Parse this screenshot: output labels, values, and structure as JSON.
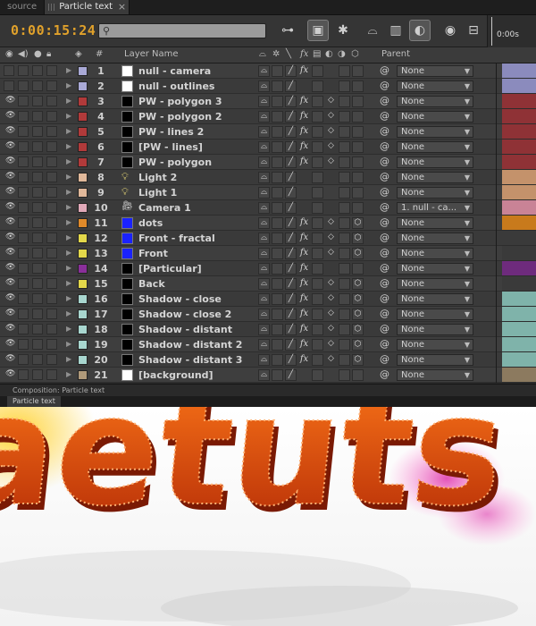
{
  "tabs": [
    {
      "label": "source",
      "active": false
    },
    {
      "label": "Particle text",
      "active": true
    }
  ],
  "toolbar": {
    "timecode": "0:00:15:24",
    "search_placeholder": "",
    "ruler_label": "0:00s"
  },
  "header": {
    "layer_name": "Layer Name",
    "hash": "#",
    "parent": "Parent"
  },
  "layers": [
    {
      "num": "1",
      "name": "null - camera",
      "label_color": "#a9a9d6",
      "src": "white",
      "eye": false,
      "fx": true,
      "switch3d": false,
      "motionblur": false,
      "parent": "None",
      "bar_color": "#8b8bbd"
    },
    {
      "num": "2",
      "name": "null - outlines",
      "label_color": "#a9a9d6",
      "src": "white",
      "eye": false,
      "fx": false,
      "switch3d": false,
      "motionblur": false,
      "parent": "None",
      "bar_color": "#8b8bbd"
    },
    {
      "num": "3",
      "name": "PW - polygon 3",
      "label_color": "#b13a3a",
      "src": "black",
      "eye": true,
      "fx": true,
      "switch3d": false,
      "motionblur": true,
      "parent": "None",
      "bar_color": "#8f3236"
    },
    {
      "num": "4",
      "name": "PW - polygon 2",
      "label_color": "#b13a3a",
      "src": "black",
      "eye": true,
      "fx": true,
      "switch3d": false,
      "motionblur": true,
      "parent": "None",
      "bar_color": "#8f3236"
    },
    {
      "num": "5",
      "name": "PW - lines 2",
      "label_color": "#b13a3a",
      "src": "black",
      "eye": true,
      "fx": true,
      "switch3d": false,
      "motionblur": true,
      "parent": "None",
      "bar_color": "#8f3236"
    },
    {
      "num": "6",
      "name": "[PW - lines]",
      "label_color": "#b13a3a",
      "src": "black",
      "eye": true,
      "fx": true,
      "switch3d": false,
      "motionblur": true,
      "parent": "None",
      "bar_color": "#8f3236"
    },
    {
      "num": "7",
      "name": "PW - polygon",
      "label_color": "#b13a3a",
      "src": "black",
      "eye": true,
      "fx": true,
      "switch3d": false,
      "motionblur": true,
      "parent": "None",
      "bar_color": "#8f3236"
    },
    {
      "num": "8",
      "name": "Light 2",
      "label_color": "#e0b89a",
      "src": "light",
      "eye": true,
      "fx": false,
      "switch3d": false,
      "motionblur": false,
      "parent": "None",
      "bar_color": "#c4926b"
    },
    {
      "num": "9",
      "name": "Light 1",
      "label_color": "#e0b89a",
      "src": "light",
      "eye": true,
      "fx": false,
      "switch3d": false,
      "motionblur": false,
      "parent": "None",
      "bar_color": "#c4926b"
    },
    {
      "num": "10",
      "name": "Camera 1",
      "label_color": "#e0a8b8",
      "src": "camera",
      "eye": true,
      "fx": false,
      "switch3d": false,
      "motionblur": false,
      "parent": "1. null - ca...",
      "bar_color": "#c98396"
    },
    {
      "num": "11",
      "name": "dots",
      "label_color": "#e08a2a",
      "src": "blue",
      "eye": true,
      "fx": true,
      "switch3d": true,
      "motionblur": true,
      "parent": "None",
      "bar_color": "#c87a1c"
    },
    {
      "num": "12",
      "name": "Front - fractal",
      "label_color": "#e3d84a",
      "src": "blue",
      "eye": true,
      "fx": true,
      "switch3d": true,
      "motionblur": true,
      "parent": "None",
      "bar_color": "#3a3a3a"
    },
    {
      "num": "13",
      "name": "Front",
      "label_color": "#e3d84a",
      "src": "blue",
      "eye": true,
      "fx": true,
      "switch3d": true,
      "motionblur": true,
      "parent": "None",
      "bar_color": "#3a3a3a"
    },
    {
      "num": "14",
      "name": "[Particular]",
      "label_color": "#8a2f9a",
      "src": "black",
      "eye": true,
      "fx": true,
      "switch3d": false,
      "motionblur": false,
      "parent": "None",
      "bar_color": "#6e2b7d"
    },
    {
      "num": "15",
      "name": "Back",
      "label_color": "#e3d84a",
      "src": "black",
      "eye": true,
      "fx": true,
      "switch3d": true,
      "motionblur": true,
      "parent": "None",
      "bar_color": "#3a3a3a"
    },
    {
      "num": "16",
      "name": "Shadow - close",
      "label_color": "#a8d6cf",
      "src": "black",
      "eye": true,
      "fx": true,
      "switch3d": true,
      "motionblur": true,
      "parent": "None",
      "bar_color": "#7fb3aa"
    },
    {
      "num": "17",
      "name": "Shadow - close 2",
      "label_color": "#a8d6cf",
      "src": "black",
      "eye": true,
      "fx": true,
      "switch3d": true,
      "motionblur": true,
      "parent": "None",
      "bar_color": "#7fb3aa"
    },
    {
      "num": "18",
      "name": "Shadow - distant",
      "label_color": "#a8d6cf",
      "src": "black",
      "eye": true,
      "fx": true,
      "switch3d": true,
      "motionblur": true,
      "parent": "None",
      "bar_color": "#7fb3aa"
    },
    {
      "num": "19",
      "name": "Shadow - distant 2",
      "label_color": "#a8d6cf",
      "src": "black",
      "eye": true,
      "fx": true,
      "switch3d": true,
      "motionblur": true,
      "parent": "None",
      "bar_color": "#7fb3aa"
    },
    {
      "num": "20",
      "name": "Shadow - distant 3",
      "label_color": "#a8d6cf",
      "src": "black",
      "eye": true,
      "fx": true,
      "switch3d": true,
      "motionblur": true,
      "parent": "None",
      "bar_color": "#7fb3aa"
    },
    {
      "num": "21",
      "name": "[background]",
      "label_color": "#b09a7a",
      "src": "white",
      "eye": true,
      "fx": false,
      "switch3d": false,
      "motionblur": false,
      "parent": "None",
      "bar_color": "#8c7a5f"
    }
  ],
  "composition_label": "Composition: Particle text",
  "composition_tab": "Particle text",
  "viewer": {
    "text": "aetuts",
    "text_color": "#e04a12"
  }
}
